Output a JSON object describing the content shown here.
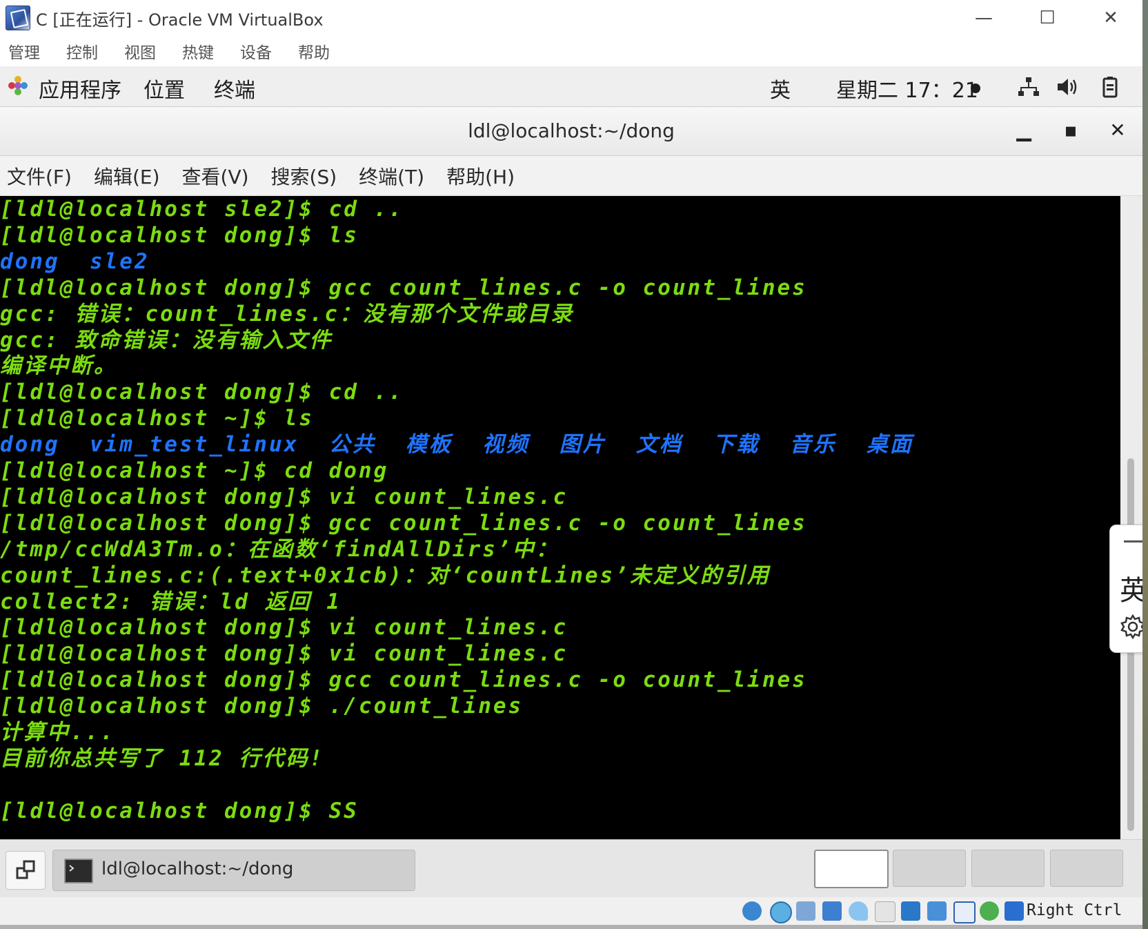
{
  "host_window": {
    "title": "C [正在运行] - Oracle VM VirtualBox",
    "controls": {
      "minimize": "—",
      "maximize": "☐",
      "close": "✕"
    },
    "menu": [
      "管理",
      "控制",
      "视图",
      "热键",
      "设备",
      "帮助"
    ]
  },
  "guest_topbar": {
    "applications": "应用程序",
    "places": "位置",
    "terminal": "终端",
    "input_method": "英",
    "clock": "星期二 17：21"
  },
  "terminal_window": {
    "title": "ldl@localhost:~/dong",
    "controls": {
      "minimize": "▁",
      "maximize": "▪",
      "close": "✕"
    },
    "menu": [
      "文件(F)",
      "编辑(E)",
      "查看(V)",
      "搜索(S)",
      "终端(T)",
      "帮助(H)"
    ],
    "lines": [
      {
        "text": "[ldl@localhost sle2]$ cd ..",
        "color": "green"
      },
      {
        "text": "[ldl@localhost dong]$ ls",
        "color": "green"
      },
      {
        "text": "dong  sle2",
        "color": "blue"
      },
      {
        "text": "[ldl@localhost dong]$ gcc count_lines.c -o count_lines",
        "color": "green"
      },
      {
        "text": "gcc: 错误：count_lines.c：没有那个文件或目录",
        "color": "green"
      },
      {
        "text": "gcc: 致命错误：没有输入文件",
        "color": "green"
      },
      {
        "text": "编译中断。",
        "color": "green"
      },
      {
        "text": "[ldl@localhost dong]$ cd ..",
        "color": "green"
      },
      {
        "text": "[ldl@localhost ~]$ ls",
        "color": "green"
      },
      {
        "text": "dong  vim_test_linux  公共  模板  视频  图片  文档  下载  音乐  桌面",
        "color": "blue"
      },
      {
        "text": "[ldl@localhost ~]$ cd dong",
        "color": "green"
      },
      {
        "text": "[ldl@localhost dong]$ vi count_lines.c",
        "color": "green"
      },
      {
        "text": "[ldl@localhost dong]$ gcc count_lines.c -o count_lines",
        "color": "green"
      },
      {
        "text": "/tmp/ccWdA3Tm.o：在函数‘findAllDirs’中：",
        "color": "green"
      },
      {
        "text": "count_lines.c:(.text+0x1cb)：对‘countLines’未定义的引用",
        "color": "green"
      },
      {
        "text": "collect2: 错误：ld 返回 1",
        "color": "green"
      },
      {
        "text": "[ldl@localhost dong]$ vi count_lines.c",
        "color": "green"
      },
      {
        "text": "[ldl@localhost dong]$ vi count_lines.c",
        "color": "green"
      },
      {
        "text": "[ldl@localhost dong]$ gcc count_lines.c -o count_lines",
        "color": "green"
      },
      {
        "text": "[ldl@localhost dong]$ ./count_lines",
        "color": "green"
      },
      {
        "text": "计算中...",
        "color": "green"
      },
      {
        "text": "目前你总共写了 112 行代码!",
        "color": "green"
      },
      {
        "text": "",
        "color": "green"
      },
      {
        "text": "[ldl@localhost dong]$ SS",
        "color": "green"
      }
    ]
  },
  "ime_panel": {
    "char": "英"
  },
  "taskbar": {
    "task_label": "ldl@localhost:~/dong",
    "workspaces": 4,
    "active_workspace": 1
  },
  "statusbar": {
    "host_key": "Right Ctrl"
  },
  "colors": {
    "prompt_green": "#7bdc10",
    "dir_blue": "#1e73ff",
    "terminal_bg": "#000000"
  }
}
